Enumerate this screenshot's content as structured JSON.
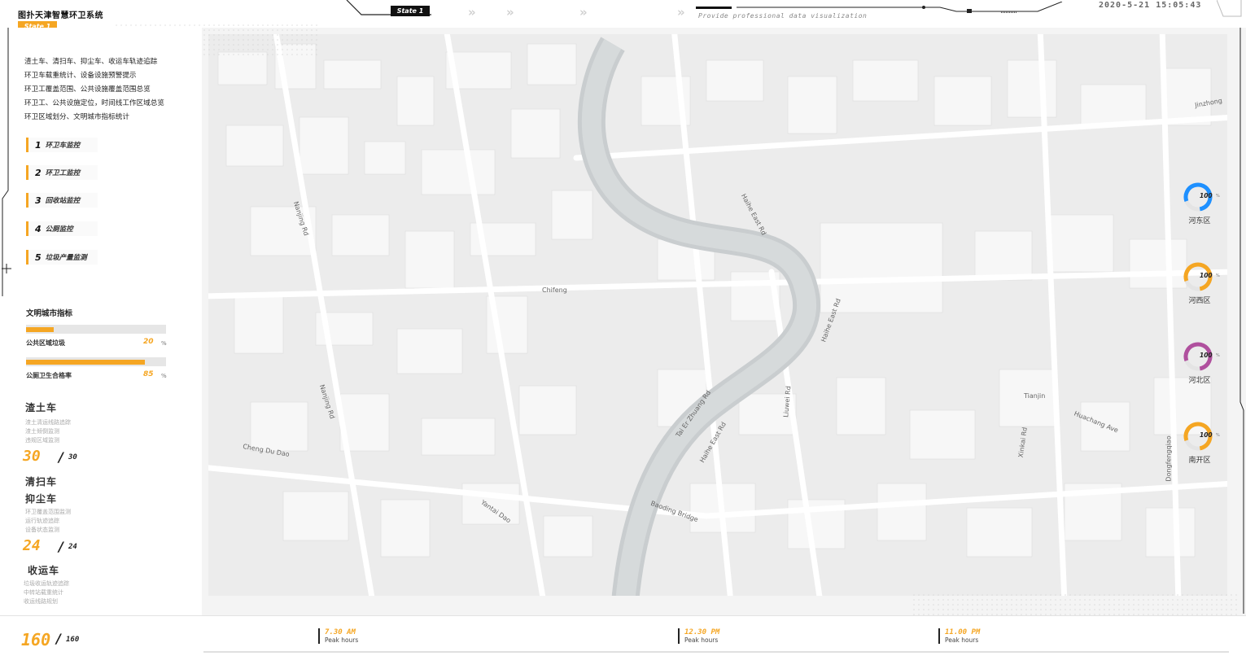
{
  "header": {
    "app_title": "图扑天津智慧环卫系统",
    "state_badge": "State 1",
    "state_tab": "State 1",
    "subtitle": "Provide professional data visualization",
    "datetime": "2020-5-21 15:05:43"
  },
  "sidebar": {
    "descriptions": [
      "渣土车、清扫车、抑尘车、收运车轨迹追踪",
      "环卫车载重统计、设备设施预警提示",
      "环卫工覆盖范围、公共设施覆盖范围总览",
      "环卫工、公共设施定位，时间线工作区域总览",
      "环卫区域划分、文明城市指标统计"
    ],
    "menu": [
      {
        "num": "1",
        "label": "环卫车监控"
      },
      {
        "num": "2",
        "label": "环卫工监控"
      },
      {
        "num": "3",
        "label": "回收站监控"
      },
      {
        "num": "4",
        "label": "公厕监控"
      },
      {
        "num": "5",
        "label": "垃圾产量监测"
      }
    ],
    "metrics_title": "文明城市指标",
    "metrics": [
      {
        "label": "公共区域垃圾",
        "value": "20",
        "unit": "%",
        "fill": 0.2
      },
      {
        "label": "公厕卫生合格率",
        "value": "85",
        "unit": "%",
        "fill": 0.85
      }
    ],
    "vehicles": [
      {
        "title": "渣土车",
        "subs": [
          "渣土清运线路追踪",
          "渣土倾倒监测",
          "违规区域监测"
        ],
        "count": "30",
        "total": "30"
      },
      {
        "title": "清扫车",
        "subs": [],
        "count": "",
        "total": ""
      },
      {
        "title": "抑尘车",
        "subs": [
          "环卫覆盖范围监测",
          "运行轨迹追踪",
          "设备状态监测"
        ],
        "count": "24",
        "total": "24"
      },
      {
        "title": "收运车",
        "subs": [
          "垃圾收运轨迹追踪",
          "中转站载重统计",
          "收运线路规划"
        ],
        "count": "",
        "total": ""
      }
    ],
    "grand_count": "160",
    "grand_total": "160"
  },
  "timeline": [
    {
      "time": "7.30 AM",
      "label": "Peak hours"
    },
    {
      "time": "12.30 PM",
      "label": "Peak hours"
    },
    {
      "time": "11.00 PM",
      "label": "Peak hours"
    }
  ],
  "districts": [
    {
      "name": "河东区",
      "value": "100",
      "unit": "%",
      "color": "#1e90ff",
      "fraction": 0.78
    },
    {
      "name": "河西区",
      "value": "100",
      "unit": "%",
      "color": "#f5a623",
      "fraction": 0.78
    },
    {
      "name": "河北区",
      "value": "100",
      "unit": "%",
      "color": "#b0509e",
      "fraction": 0.78
    },
    {
      "name": "南开区",
      "value": "100",
      "unit": "%",
      "color": "#f5a623",
      "fraction": 0.78
    }
  ],
  "map_labels": [
    "Nanjing Rd",
    "Nanjing Rd",
    "Haihe East Rd",
    "Haihe East Rd",
    "Tai Er Zhuang Rd",
    "Baoding Bridge",
    "Liuwei Rd",
    "Huachang Ave",
    "Xinkai Rd",
    "Dongfengqiao",
    "Jinzhong",
    "Chifeng",
    "Yantai Dao",
    "Cheng Du Dao",
    "Tianjin",
    "Haihe East Rd"
  ]
}
